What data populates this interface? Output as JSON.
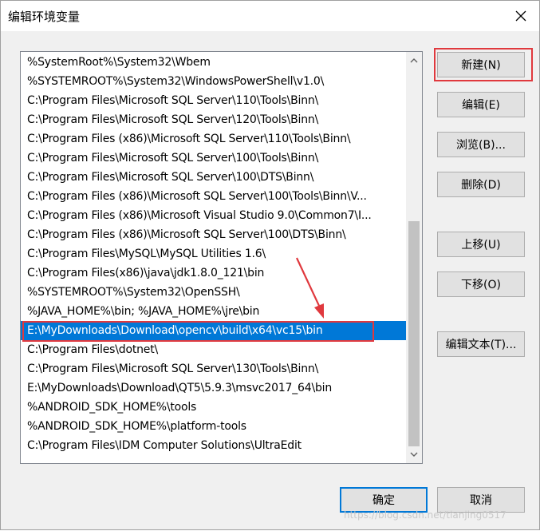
{
  "window": {
    "title": "编辑环境变量"
  },
  "path_list": [
    "%SystemRoot%\\System32\\Wbem",
    "%SYSTEMROOT%\\System32\\WindowsPowerShell\\v1.0\\",
    "C:\\Program Files\\Microsoft SQL Server\\110\\Tools\\Binn\\",
    "C:\\Program Files\\Microsoft SQL Server\\120\\Tools\\Binn\\",
    "C:\\Program Files (x86)\\Microsoft SQL Server\\110\\Tools\\Binn\\",
    "C:\\Program Files\\Microsoft SQL Server\\100\\Tools\\Binn\\",
    "C:\\Program Files\\Microsoft SQL Server\\100\\DTS\\Binn\\",
    "C:\\Program Files (x86)\\Microsoft SQL Server\\100\\Tools\\Binn\\V...",
    "C:\\Program Files (x86)\\Microsoft Visual Studio 9.0\\Common7\\I...",
    "C:\\Program Files (x86)\\Microsoft SQL Server\\100\\DTS\\Binn\\",
    "C:\\Program Files\\MySQL\\MySQL Utilities 1.6\\",
    "C:\\Program Files(x86)\\java\\jdk1.8.0_121\\bin",
    "%SYSTEMROOT%\\System32\\OpenSSH\\",
    "%JAVA_HOME%\\bin;  %JAVA_HOME%\\jre\\bin",
    "E:\\MyDownloads\\Download\\opencv\\build\\x64\\vc15\\bin",
    "C:\\Program Files\\dotnet\\",
    "C:\\Program Files\\Microsoft SQL Server\\130\\Tools\\Binn\\",
    "E:\\MyDownloads\\Download\\QT5\\5.9.3\\msvc2017_64\\bin",
    "%ANDROID_SDK_HOME%\\tools",
    "%ANDROID_SDK_HOME%\\platform-tools",
    "C:\\Program Files\\IDM Computer Solutions\\UltraEdit"
  ],
  "selected_index": 14,
  "buttons": {
    "new": "新建(N)",
    "edit": "编辑(E)",
    "browse": "浏览(B)...",
    "delete": "删除(D)",
    "move_up": "上移(U)",
    "move_down": "下移(O)",
    "edit_text": "编辑文本(T)...",
    "ok": "确定",
    "cancel": "取消"
  },
  "icons": {
    "close": "close-icon",
    "scroll_up": "chevron-up-icon",
    "scroll_down": "chevron-down-icon"
  },
  "colors": {
    "selection": "#0078d7",
    "annotation": "#e0393e"
  },
  "watermark": "https://blog.csdn.net/tianjing0517"
}
